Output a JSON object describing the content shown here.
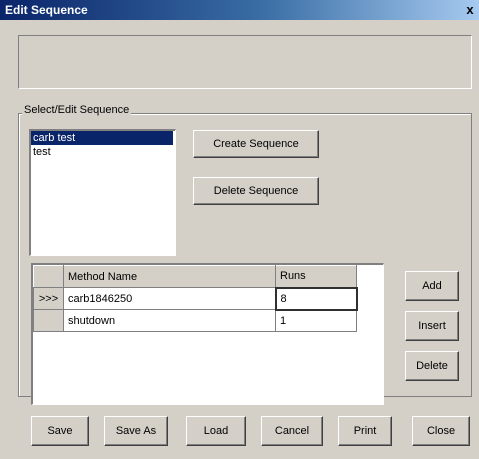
{
  "window": {
    "title": "Edit Sequence",
    "close_glyph": "x"
  },
  "group": {
    "label": "Select/Edit Sequence"
  },
  "sequence_list": {
    "items": [
      {
        "label": "carb test",
        "selected": true
      },
      {
        "label": "test",
        "selected": false
      }
    ]
  },
  "buttons": {
    "create_sequence": "Create Sequence",
    "delete_sequence": "Delete Sequence",
    "add": "Add",
    "insert": "Insert",
    "delete": "Delete",
    "save": "Save",
    "save_as": "Save As",
    "load": "Load",
    "cancel": "Cancel",
    "print": "Print",
    "close": "Close"
  },
  "methods_grid": {
    "headers": {
      "method_name": "Method Name",
      "runs": "Runs"
    },
    "rows": [
      {
        "indicator": ">>>",
        "method_name": "carb1846250",
        "runs": "8"
      },
      {
        "indicator": "",
        "method_name": "shutdown",
        "runs": "1"
      }
    ]
  },
  "colors": {
    "title_bar": "#0a246a",
    "selection": "#0a246a",
    "face": "#d4d0c8"
  }
}
